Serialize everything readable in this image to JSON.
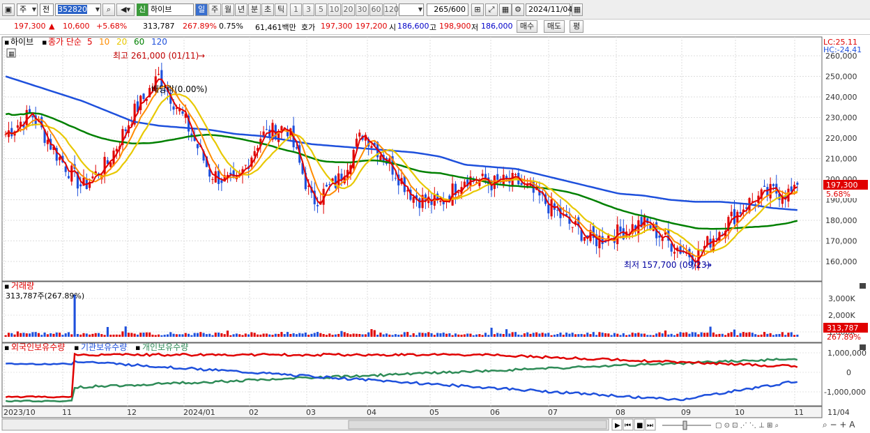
{
  "toolbar": {
    "mode_select": "주",
    "type_select": "전",
    "code": "352820",
    "market_badge": "신",
    "stock_name": "하이브",
    "periods": [
      "일",
      "주",
      "월",
      "년",
      "분",
      "초",
      "틱"
    ],
    "active_period": "일",
    "intervals": [
      "1",
      "3",
      "5",
      "10",
      "20",
      "30",
      "60",
      "120"
    ],
    "count_shown": "265",
    "count_total": "/600",
    "date": "2024/11/04"
  },
  "quote": {
    "price": "197,300",
    "arrow": "▲",
    "change": "10,600",
    "change_pct": "+5.68%",
    "volume": "313,787",
    "volume_pct": "267.89%",
    "turnover": "0.75%",
    "amount": "61,461백만",
    "ask_label": "호가",
    "ask": "197,300",
    "bid": "197,200",
    "open_label": "시",
    "open": "186,600",
    "high_label": "고",
    "high": "198,900",
    "low_label": "저",
    "low": "186,000",
    "buy_button": "매수",
    "sell_button": "매도",
    "eval_button": "평"
  },
  "price_panel": {
    "stock": "하이브",
    "ma_label": "종가 단순",
    "ma_periods": [
      {
        "label": "5",
        "color": "#e00000"
      },
      {
        "label": "10",
        "color": "#ff8c00"
      },
      {
        "label": "20",
        "color": "#e8c800"
      },
      {
        "label": "60",
        "color": "#008000"
      },
      {
        "label": "120",
        "color": "#1e50dc"
      }
    ],
    "lc": "LC:25.11",
    "hc": "HC:-24.41",
    "max_label": "최고 261,000 (01/11)",
    "min_label": "최저 157,700 (09/23)",
    "dividend_label": "배당락(0.00%)",
    "current_price": "197,300",
    "current_pct": "5.68%",
    "yaxis": [
      "260,000",
      "250,000",
      "240,000",
      "230,000",
      "220,000",
      "210,000",
      "200,000",
      "190,000",
      "180,000",
      "170,000",
      "160,000"
    ]
  },
  "volume_panel": {
    "title": "거래량",
    "info": "313,787주(267.89%)",
    "yaxis": [
      "3,000K",
      "2,000K",
      "1,000K"
    ],
    "current": "313,787",
    "current_pct": "267.89%"
  },
  "holding_panel": {
    "series": [
      {
        "name": "외국인보유수량",
        "color": "#e00000"
      },
      {
        "name": "기관보유수량",
        "color": "#1e50dc"
      },
      {
        "name": "개인보유수량",
        "color": "#2e8b57"
      }
    ],
    "yaxis": [
      "1,000,000",
      "0",
      "-1,000,000"
    ]
  },
  "xaxis": {
    "labels": [
      "2023/10",
      "11",
      "12",
      "2024/01",
      "02",
      "03",
      "04",
      "05",
      "06",
      "07",
      "08",
      "09",
      "10",
      "11"
    ],
    "right_label": "11/04"
  },
  "chart_data": [
    {
      "type": "candlestick",
      "title": "하이브",
      "ylim": [
        150000,
        265000
      ],
      "x": [
        "2023/10",
        "11",
        "12",
        "2024/01",
        "02",
        "03",
        "04",
        "05",
        "06",
        "07",
        "08",
        "09",
        "10",
        "11"
      ],
      "series": [
        {
          "name": "5",
          "values": [
            222000,
            232000,
            212000,
            196000,
            208000,
            232000,
            250000,
            229000,
            203000,
            197000,
            221000,
            226000,
            189000,
            199000,
            223000,
            208000,
            191000,
            188000,
            201000,
            198000,
            199000,
            190000,
            179000,
            170000,
            174000,
            179000,
            169000,
            162000,
            176000,
            188000,
            194000,
            193000
          ]
        },
        {
          "name": "120",
          "values": [
            250000,
            246000,
            242000,
            238000,
            233000,
            228000,
            226000,
            225000,
            224000,
            222000,
            221000,
            219000,
            217000,
            216000,
            215000,
            214000,
            213000,
            211000,
            207000,
            206000,
            205000,
            202000,
            199000,
            196000,
            193000,
            192000,
            190000,
            189000,
            189000,
            188000,
            186000,
            185000
          ]
        }
      ],
      "highlights": {
        "max": 261000,
        "max_date": "01/11",
        "min": 157700,
        "min_date": "09/23",
        "last": 197300
      }
    },
    {
      "type": "bar",
      "title": "거래량",
      "ylim": [
        0,
        3500000
      ],
      "last": 313787
    }
  ]
}
